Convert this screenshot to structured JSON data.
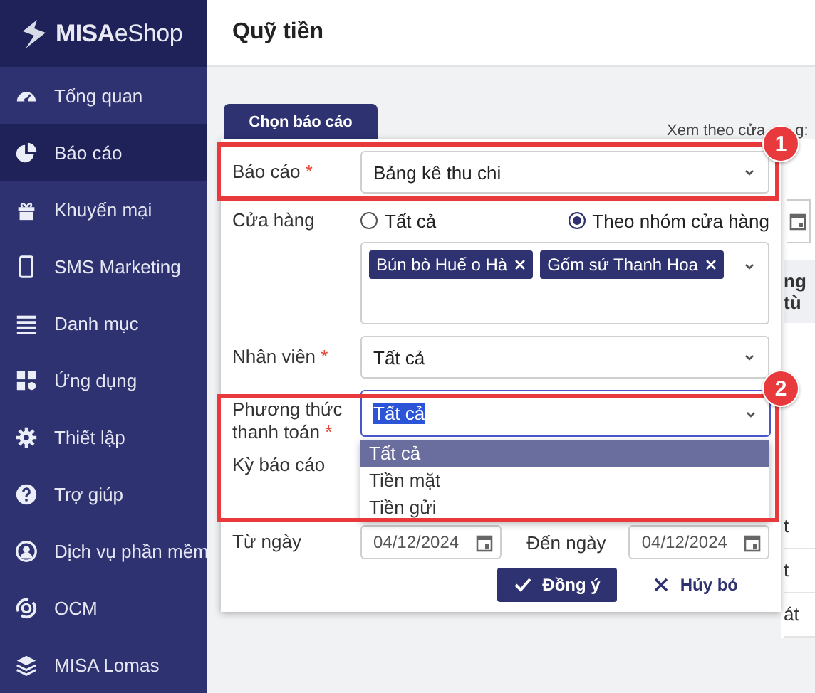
{
  "logo": {
    "text": "**MISA**eShop"
  },
  "sidebar": {
    "items": [
      {
        "label": "Tổng quan",
        "kind": "gauge",
        "selected": false
      },
      {
        "label": "Báo cáo",
        "kind": "pie",
        "selected": true
      },
      {
        "label": "Khuyến mại",
        "kind": "gift",
        "selected": false
      },
      {
        "label": "SMS Marketing",
        "kind": "phone",
        "selected": false
      },
      {
        "label": "Danh mục",
        "kind": "list",
        "selected": false
      },
      {
        "label": "Ứng dụng",
        "kind": "apps",
        "selected": false
      },
      {
        "label": "Thiết lập",
        "kind": "gear",
        "selected": false
      },
      {
        "label": "Trợ giúp",
        "kind": "help",
        "selected": false
      },
      {
        "label": "Dịch vụ phần mềm",
        "kind": "user",
        "selected": false
      },
      {
        "label": "OCM",
        "kind": "swirl",
        "selected": false
      },
      {
        "label": "MISA Lomas",
        "kind": "layers",
        "selected": false
      }
    ]
  },
  "header": {
    "title": "Quỹ tiền"
  },
  "background": {
    "view_label": "Xem theo cửa",
    "view_label_tail": "g:",
    "column_header": "ng tù",
    "cells": [
      "t",
      "t",
      "át"
    ]
  },
  "dialog": {
    "tab": {
      "label": "Chọn báo cáo",
      "selected": true
    },
    "report": {
      "label": "Báo cáo",
      "required_mark": "*",
      "value": "Bảng kê thu chi"
    },
    "store": {
      "label": "Cửa hàng",
      "options": [
        {
          "label": "Tất cả",
          "selected": false
        },
        {
          "label": "Theo nhóm cửa hàng",
          "selected": true
        }
      ],
      "tags": [
        "Bún bò Huế o Hà",
        "Gốm sứ Thanh Hoa"
      ]
    },
    "employee": {
      "label": "Nhân viên",
      "required_mark": "*",
      "value": "Tất cả"
    },
    "payment": {
      "label": "Phương thức thanh toán",
      "required_mark": "*",
      "value": "Tất cả",
      "options": [
        {
          "label": "Tất cả",
          "selected": true
        },
        {
          "label": "Tiền mặt",
          "selected": false
        },
        {
          "label": "Tiền gửi",
          "selected": false
        }
      ]
    },
    "period": {
      "label": "Kỳ báo cáo"
    },
    "dates": {
      "from_label": "Từ ngày",
      "from_value": "04/12/2024",
      "to_label": "Đến ngày",
      "to_value": "04/12/2024"
    },
    "buttons": [
      {
        "label": "Đồng ý",
        "kind": "primary"
      },
      {
        "label": "Hủy bỏ",
        "kind": "cancel"
      }
    ]
  },
  "annotations": [
    {
      "number": "1"
    },
    {
      "number": "2"
    }
  ]
}
